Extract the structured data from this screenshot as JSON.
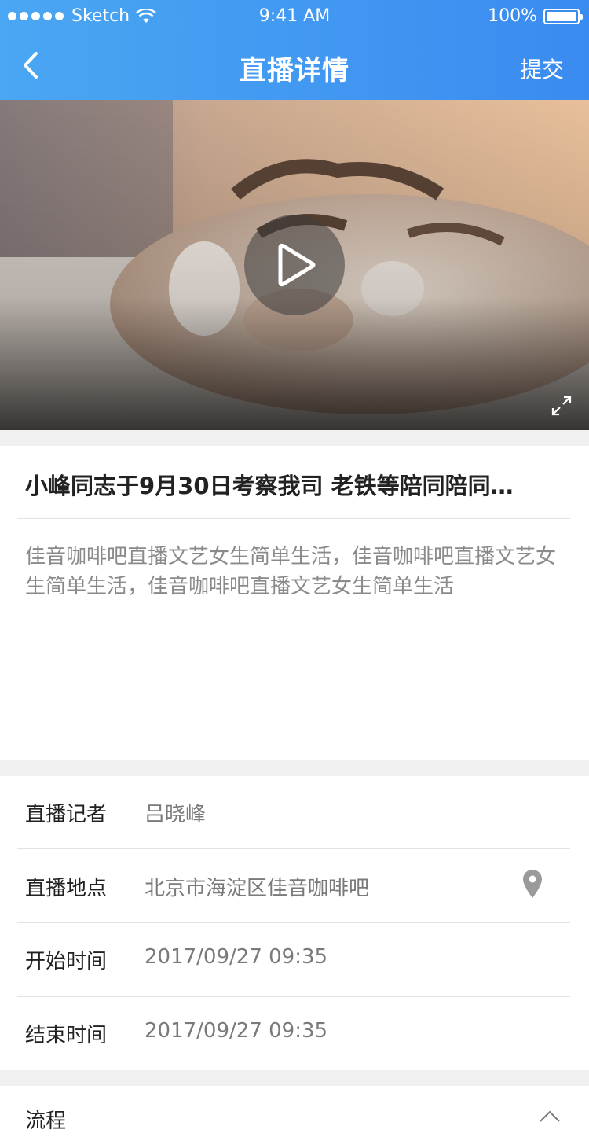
{
  "status_bar": {
    "carrier": "Sketch",
    "time": "9:41 AM",
    "battery": "100%"
  },
  "nav": {
    "back_icon": "chevron-left-icon",
    "title": "直播详情",
    "submit_label": "提交"
  },
  "video": {
    "play_icon": "play-icon",
    "fullscreen_icon": "expand-icon"
  },
  "live": {
    "title": "小峰同志于9月30日考察我司 老铁等陪同陪同…",
    "description": "佳音咖啡吧直播文艺女生简单生活，佳音咖啡吧直播文艺女生简单生活，佳音咖啡吧直播文艺女生简单生活"
  },
  "info": {
    "reporter_label": "直播记者",
    "reporter_value": "吕晓峰",
    "location_label": "直播地点",
    "location_value": "北京市海淀区佳音咖啡吧",
    "start_label": "开始时间",
    "start_value": "2017/09/27 09:35",
    "end_label": "结束时间",
    "end_value": "2017/09/27 09:35"
  },
  "process": {
    "label": "流程",
    "toggle_icon": "chevron-up-icon"
  },
  "colors": {
    "header_start": "#4aa7f3",
    "header_end": "#3a8bf0"
  }
}
